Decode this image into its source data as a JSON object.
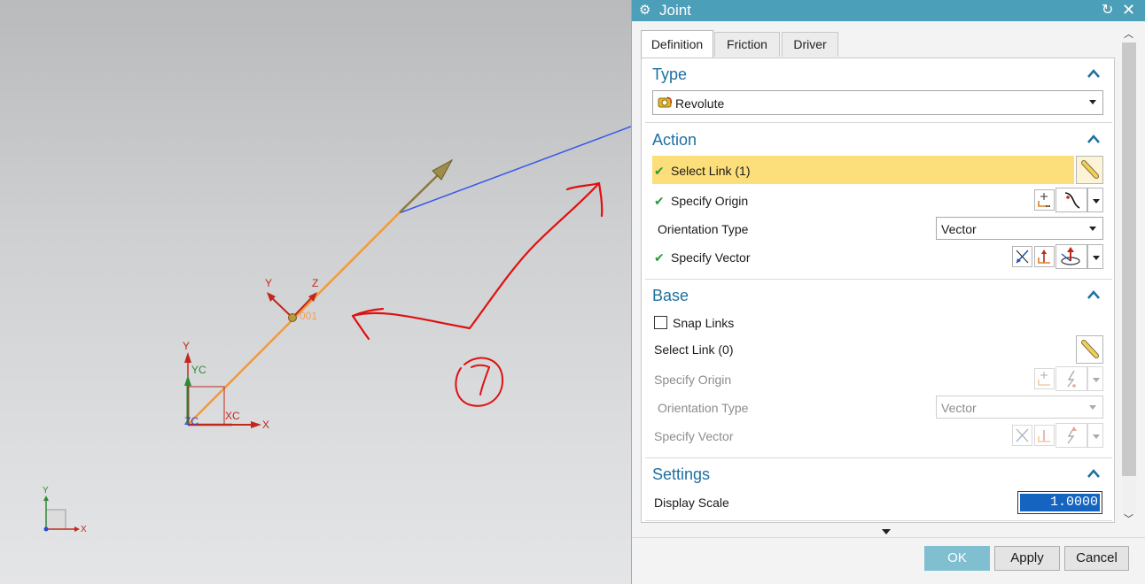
{
  "viewport": {
    "link_label": "001",
    "csys_labels": {
      "x": "X",
      "y": "Y",
      "xc": "XC",
      "yc": "YC",
      "zc": "ZC",
      "z": "Z",
      "local_y": "Y",
      "local_z": "Z"
    },
    "mini_triad": {
      "x": "X",
      "y": "Y"
    }
  },
  "dialog": {
    "title": "Joint",
    "tabs": [
      "Definition",
      "Friction",
      "Driver"
    ],
    "type_section": {
      "title": "Type",
      "selected": "Revolute"
    },
    "action_section": {
      "title": "Action",
      "select_link": "Select Link (1)",
      "specify_origin": "Specify Origin",
      "orientation_type_label": "Orientation Type",
      "orientation_type_value": "Vector",
      "specify_vector": "Specify Vector"
    },
    "base_section": {
      "title": "Base",
      "snap_links": "Snap Links",
      "snap_links_checked": false,
      "select_link": "Select Link (0)",
      "specify_origin": "Specify Origin",
      "orientation_type_label": "Orientation Type",
      "orientation_type_value": "Vector",
      "specify_vector": "Specify Vector"
    },
    "settings_section": {
      "title": "Settings",
      "display_scale_label": "Display Scale",
      "display_scale_value": "1.0000"
    },
    "buttons": {
      "ok": "OK",
      "apply": "Apply",
      "cancel": "Cancel"
    }
  },
  "colors": {
    "titlebar": "#4c9fb8",
    "section_title": "#1e6fa0",
    "highlight": "#fcde7a",
    "ok_button": "#7fbfd0",
    "annotation": "#e01010"
  }
}
